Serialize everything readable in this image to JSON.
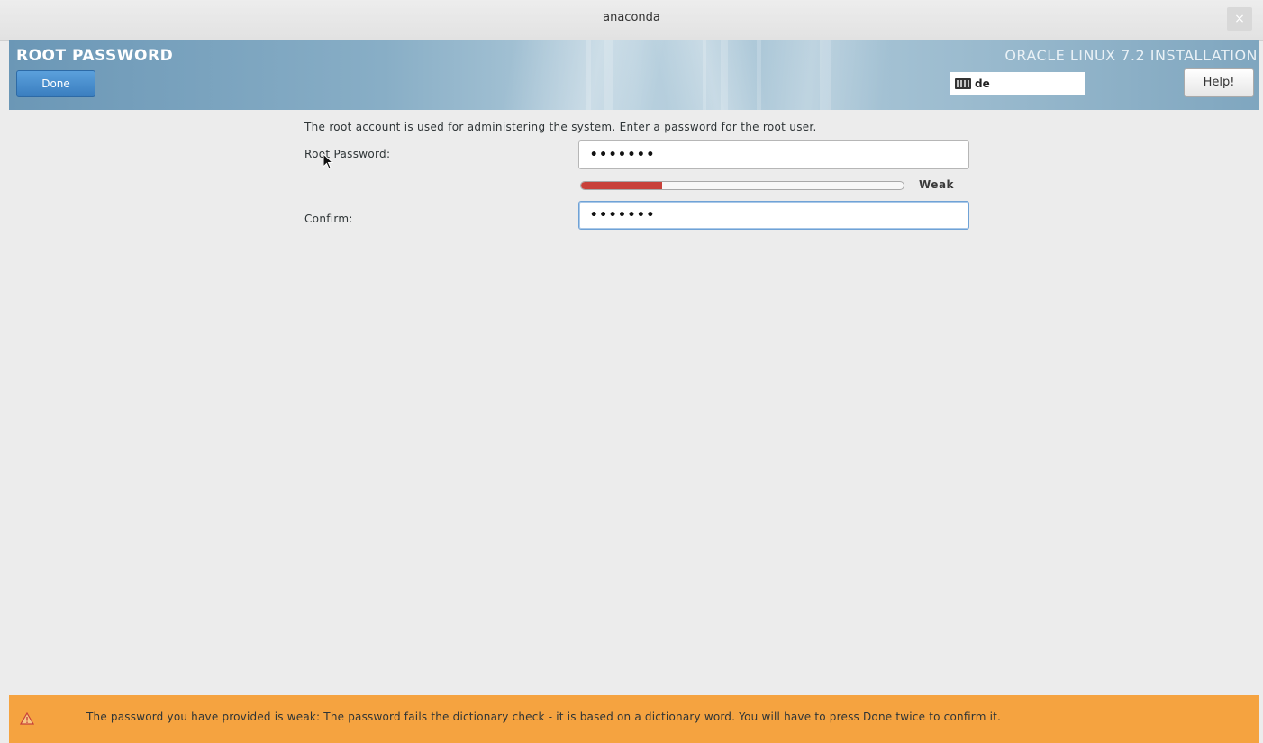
{
  "window": {
    "title": "anaconda",
    "close_glyph": "×"
  },
  "header": {
    "spoke_title": "ROOT PASSWORD",
    "done_label": "Done",
    "product_title": "ORACLE LINUX 7.2 INSTALLATION",
    "keyboard_layout": "de",
    "help_label": "Help!"
  },
  "form": {
    "intro": "The root account is used for administering the system.  Enter a password for the root user.",
    "root_password_label": "Root Password:",
    "root_password_value": "•••••••",
    "strength": {
      "fraction": 0.25,
      "label": "Weak",
      "color": "#c8413a"
    },
    "confirm_label": "Confirm:",
    "confirm_value": "•••••••"
  },
  "warning": {
    "icon": "warning-triangle-icon",
    "message": "The password you have provided is weak: The password fails the dictionary check - it is based on a dictionary word. You will have to press Done twice to confirm it.",
    "color": "#f5a340"
  },
  "colors": {
    "done_button": "#3a7ebf",
    "warning_bar": "#f5a340"
  }
}
